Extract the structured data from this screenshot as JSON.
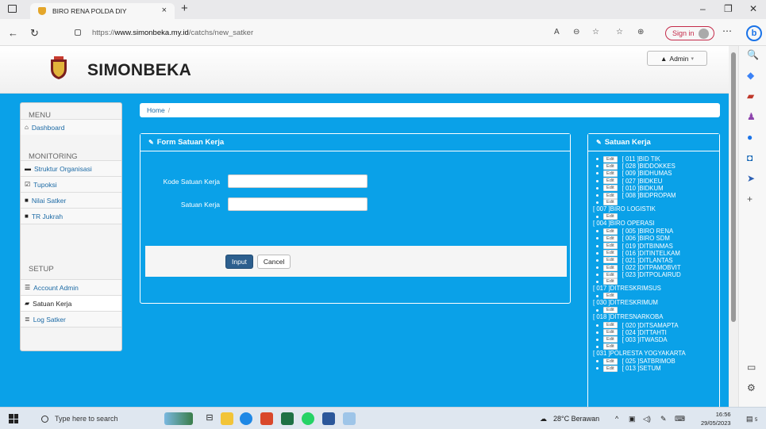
{
  "browser": {
    "tab_title": "BIRO RENA POLDA DIY",
    "url_prefix": "https://",
    "url_domain": "www.simonbeka.my.id",
    "url_path": "/catchs/new_satker",
    "sign_in_label": "Sign in"
  },
  "site": {
    "brand": "SIMONBEKA",
    "admin_label": "Admin"
  },
  "menu": {
    "menu_heading": "MENU",
    "dashboard": "Dashboard",
    "monitoring_heading": "MONITORING",
    "struktur": "Struktur Organisasi",
    "tupoksi": "Tupoksi",
    "nilai": "Nilai Satker",
    "trjukrah": "TR Jukrah",
    "setup_heading": "SETUP",
    "account": "Account Admin",
    "satuan": "Satuan Kerja",
    "log": "Log Satker"
  },
  "breadcrumb": {
    "home": "Home",
    "sep": "/"
  },
  "form": {
    "title": "Form Satuan Kerja",
    "kode_label": "Kode Satuan Kerja",
    "kode_value": "",
    "satuan_label": "Satuan Kerja",
    "satuan_value": "",
    "input_button": "Input",
    "cancel_button": "Cancel"
  },
  "satuan_panel": {
    "title": "Satuan Kerja",
    "edit_label": "Edit",
    "items": [
      "[ 011 ]BID TIK",
      "[ 028 ]BIDDOKKES",
      "[ 009 ]BIDHUMAS",
      "[ 027 ]BIDKEU",
      "[ 010 ]BIDKUM",
      "[ 008 ]BIDPROPAM",
      "[ 007 ]BIRO LOGISTIK",
      "[ 004 ]BIRO OPERASI",
      "[ 005 ]BIRO RENA",
      "[ 006 ]BIRO SDM",
      "[ 019 ]DITBINMAS",
      "[ 016 ]DITINTELKAM",
      "[ 021 ]DITLANTAS",
      "[ 022 ]DITPAMOBVIT",
      "[ 023 ]DITPOLAIRUD",
      "[ 017 ]DITRESKRIMSUS",
      "[ 030 ]DITRESKRIMUM",
      "[ 018 ]DITRESNARKOBA",
      "[ 020 ]DITSAMAPTA",
      "[ 024 ]DITTAHTI",
      "[ 003 ]ITWASDA",
      "[ 031 ]POLRESTA YOGYAKARTA",
      "[ 025 ]SATBRIMOB",
      "[ 013 ]SETUM"
    ]
  },
  "taskbar": {
    "search_placeholder": "Type here to search",
    "weather": "28°C Berawan",
    "time": "16:56",
    "date": "29/05/2023",
    "notif_count": "5"
  }
}
